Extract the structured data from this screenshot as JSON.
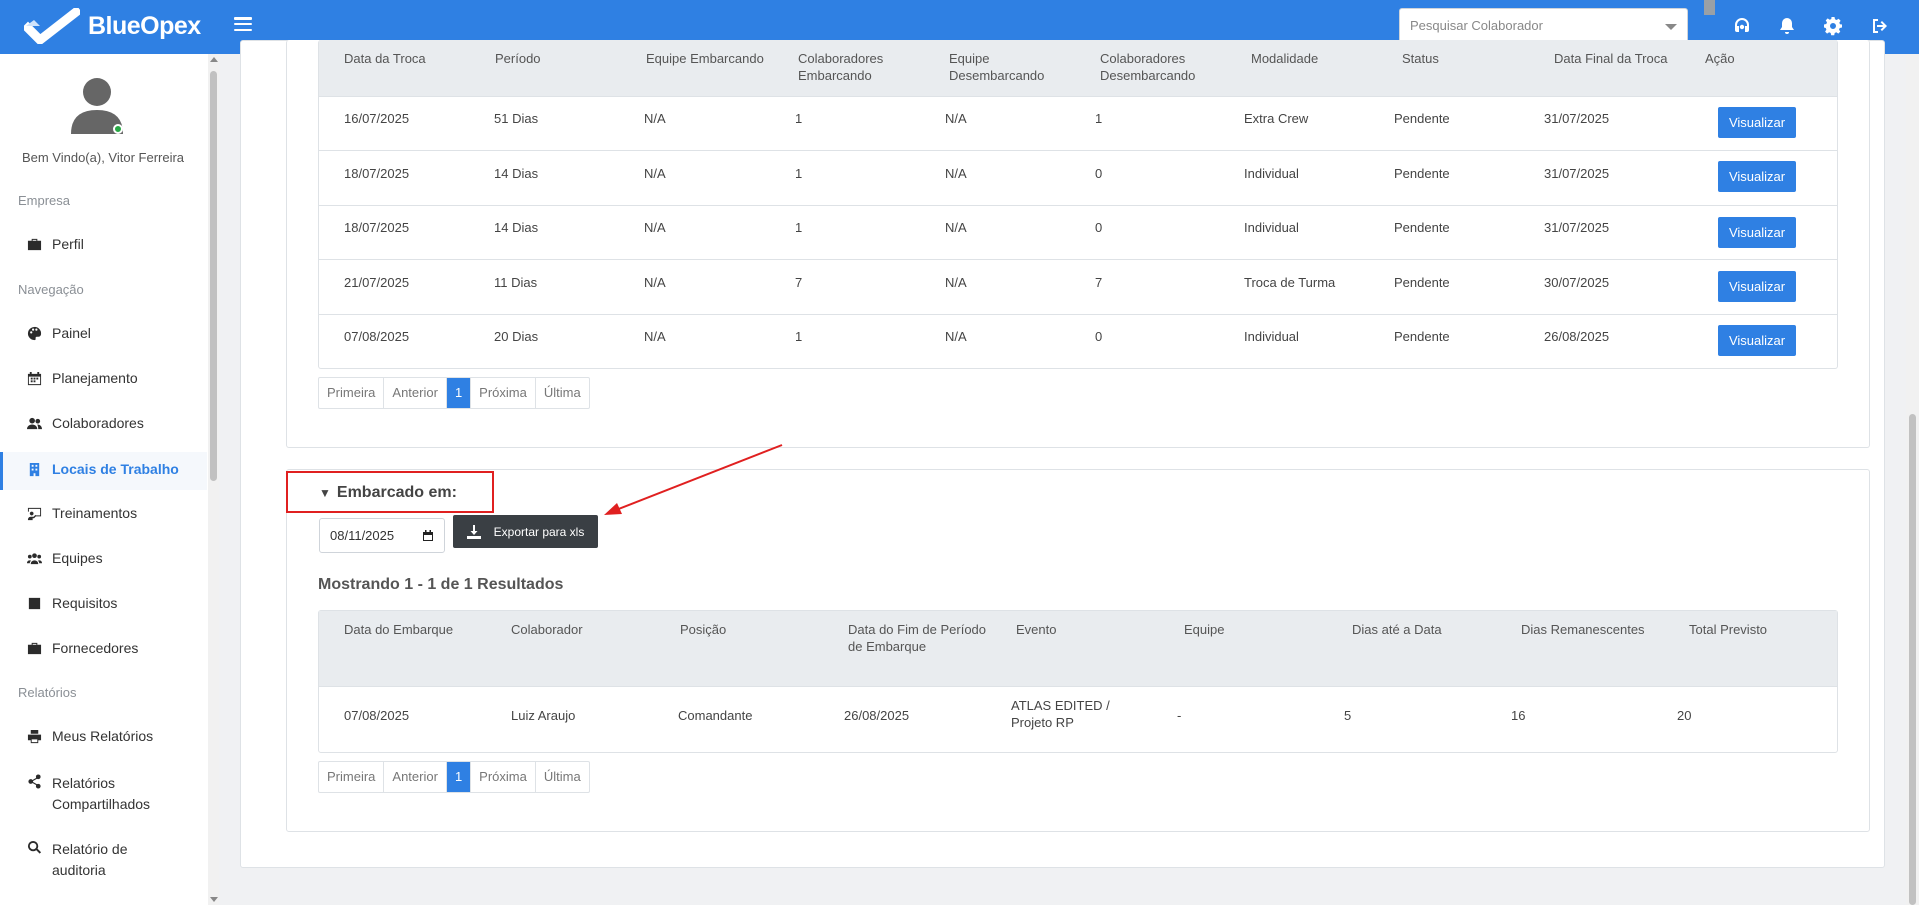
{
  "app": {
    "name": "BlueOpex"
  },
  "header": {
    "search_placeholder": "Pesquisar Colaborador"
  },
  "sidebar": {
    "welcome": "Bem Vindo(a), Vitor Ferreira",
    "sections": {
      "empresa": "Empresa",
      "navegacao": "Navegação",
      "relatorios": "Relatórios"
    },
    "items": [
      {
        "label": "Perfil",
        "icon": "briefcase-icon"
      },
      {
        "label": "Painel",
        "icon": "palette-icon"
      },
      {
        "label": "Planejamento",
        "icon": "calendar-icon"
      },
      {
        "label": "Colaboradores",
        "icon": "users-icon"
      },
      {
        "label": "Locais de Trabalho",
        "icon": "building-icon",
        "active": true
      },
      {
        "label": "Treinamentos",
        "icon": "chalkboard-icon"
      },
      {
        "label": "Equipes",
        "icon": "team-icon"
      },
      {
        "label": "Requisitos",
        "icon": "checkbox-icon"
      },
      {
        "label": "Fornecedores",
        "icon": "briefcase-icon"
      },
      {
        "label": "Meus Relatórios",
        "icon": "print-icon"
      },
      {
        "label": "Relatórios Compartilhados",
        "icon": "share-icon"
      },
      {
        "label": "Relatório de auditoria",
        "icon": "search-doc-icon"
      }
    ]
  },
  "trocas": {
    "headers": [
      "Data da Troca",
      "Período",
      "Equipe Embarcando",
      "Colaboradores Embarcando",
      "Equipe Desembarcando",
      "Colaboradores Desembarcando",
      "Modalidade",
      "Status",
      "Data Final da Troca",
      "Ação"
    ],
    "rows": [
      [
        "16/07/2025",
        "51 Dias",
        "N/A",
        "1",
        "N/A",
        "1",
        "Extra Crew",
        "Pendente",
        "31/07/2025"
      ],
      [
        "18/07/2025",
        "14 Dias",
        "N/A",
        "1",
        "N/A",
        "0",
        "Individual",
        "Pendente",
        "31/07/2025"
      ],
      [
        "18/07/2025",
        "14 Dias",
        "N/A",
        "1",
        "N/A",
        "0",
        "Individual",
        "Pendente",
        "31/07/2025"
      ],
      [
        "21/07/2025",
        "11 Dias",
        "N/A",
        "7",
        "N/A",
        "7",
        "Troca de Turma",
        "Pendente",
        "30/07/2025"
      ],
      [
        "07/08/2025",
        "20 Dias",
        "N/A",
        "1",
        "N/A",
        "0",
        "Individual",
        "Pendente",
        "26/08/2025"
      ]
    ],
    "action_label": "Visualizar"
  },
  "pager": {
    "first": "Primeira",
    "prev": "Anterior",
    "current": "1",
    "next": "Próxima",
    "last": "Última"
  },
  "embarcado": {
    "title": "Embarcado em:",
    "date_value": "08/11/2025",
    "export_label": "Exportar para xls",
    "results_text": "Mostrando 1 - 1 de 1 Resultados",
    "headers": [
      "Data do Embarque",
      "Colaborador",
      "Posição",
      "Data do Fim de Período de Embarque",
      "Evento",
      "Equipe",
      "Dias até a Data",
      "Dias Remanescentes",
      "Total Previsto"
    ],
    "rows": [
      [
        "07/08/2025",
        "Luiz Araujo",
        "Comandante",
        "26/08/2025",
        "ATLAS EDITED / Projeto RP",
        "-",
        "5",
        "16",
        "20"
      ]
    ]
  },
  "colors": {
    "brand": "#2f80e3",
    "highlight": "#e02020",
    "export_button": "#3a3f44"
  }
}
